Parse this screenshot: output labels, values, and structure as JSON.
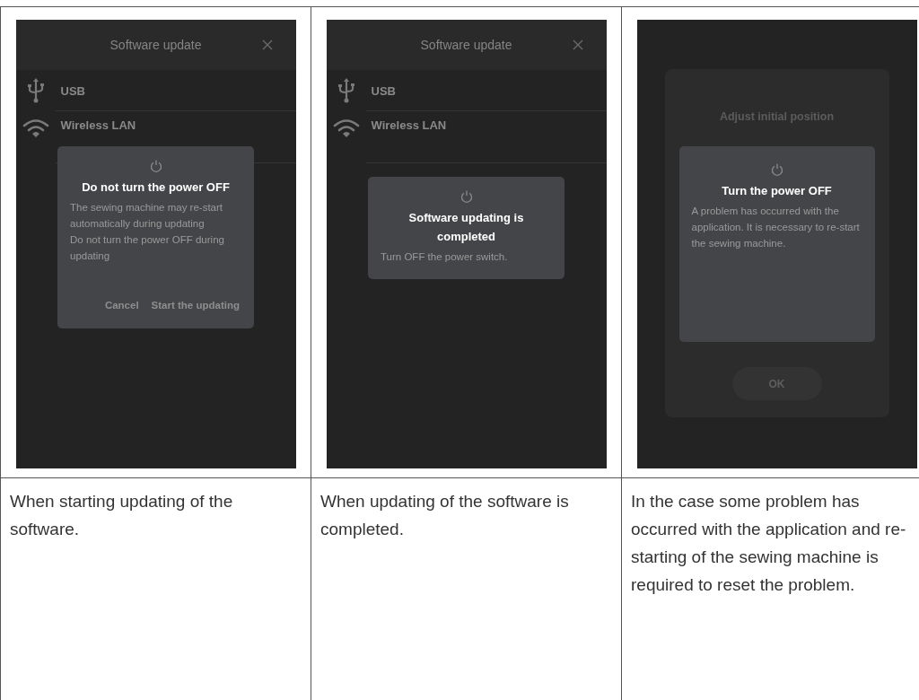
{
  "panels": [
    {
      "screen": {
        "kind": "menu",
        "title": "Software update",
        "items": [
          {
            "label": "USB"
          },
          {
            "label": "Wireless LAN"
          }
        ],
        "dialog": {
          "title": "Do not turn the power OFF",
          "message": [
            "The sewing machine may re-start automatically during updating",
            "Do not turn the power OFF during updating"
          ],
          "buttons": [
            "Cancel",
            "Start the updating"
          ]
        }
      },
      "caption": "When starting updating of the software."
    },
    {
      "screen": {
        "kind": "menu",
        "title": "Software update",
        "items": [
          {
            "label": "USB"
          },
          {
            "label": "Wireless LAN"
          }
        ],
        "dialog": {
          "title": "Software updating is completed",
          "message": [
            "Turn OFF the power switch."
          ]
        }
      },
      "caption": "When updating of the software is completed."
    },
    {
      "screen": {
        "kind": "dimmed",
        "title": "Adjust initial position",
        "button": "OK",
        "dialog": {
          "title": "Turn the power OFF",
          "message": [
            "A problem has occurred with the application. It is necessary to re-start the sewing machine."
          ]
        }
      },
      "caption": "In the case some problem has occurred with the application and re-starting of the sewing machine is required to reset the problem."
    }
  ]
}
